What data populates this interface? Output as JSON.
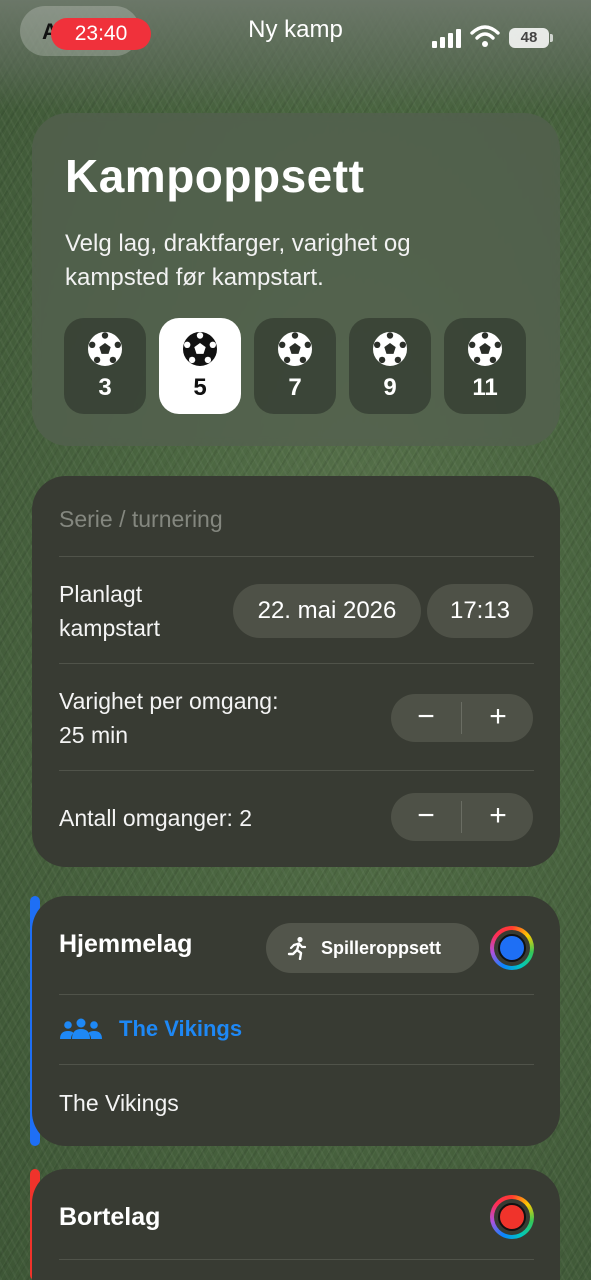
{
  "status_bar": {
    "time": "23:40",
    "back_letter": "A",
    "battery": "48"
  },
  "nav": {
    "title": "Ny kamp"
  },
  "header": {
    "title": "Kampoppsett",
    "subtitle": "Velg lag, draktfarger, varighet og kampsted før kampstart.",
    "formats": [
      {
        "value": "3",
        "selected": false
      },
      {
        "value": "5",
        "selected": true
      },
      {
        "value": "7",
        "selected": false
      },
      {
        "value": "9",
        "selected": false
      },
      {
        "value": "11",
        "selected": false
      }
    ]
  },
  "settings": {
    "series_placeholder": "Serie / turnering",
    "kickoff_label_line1": "Planlagt",
    "kickoff_label_line2": "kampstart",
    "kickoff_date": "22. mai 2026",
    "kickoff_time": "17:13",
    "duration_label_line1": "Varighet per omgang:",
    "duration_label_line2": "25 min",
    "halves_label": "Antall omganger: 2",
    "stepper_minus": "−",
    "stepper_plus": "+"
  },
  "home_team": {
    "title": "Hjemmelag",
    "lineup_button": "Spilleroppsett",
    "selected_team": "The Vikings",
    "team_name": "The Vikings",
    "accent_color": "#1e6ff5",
    "kit_color": "#1e6ff5"
  },
  "away_team": {
    "title": "Bortelag",
    "accent_color": "#f0332b",
    "kit_color": "#f0332b"
  }
}
